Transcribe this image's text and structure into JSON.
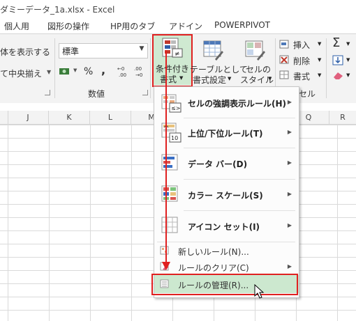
{
  "window": {
    "title": "ダミーデータ_1a.xlsx - Excel"
  },
  "tabs": [
    "個人用",
    "図形の操作",
    "HP用のタブ",
    "アドイン",
    "POWERPIVOT"
  ],
  "ribbon": {
    "text_wrap": "体を表示する",
    "merge_center": "て中央揃え",
    "number_format": "標準",
    "percent": "%",
    "comma": ",",
    "number_group": "数値",
    "cond_format_l1": "条件付き",
    "cond_format_l2": "書式",
    "table_format_l1": "テーブルとして",
    "table_format_l2": "書式設定",
    "cell_style_l1": "セルの",
    "cell_style_l2": "スタイル",
    "insert": "挿入",
    "delete": "削除",
    "format": "書式",
    "cells_group": "セル"
  },
  "columns": [
    "J",
    "K",
    "L",
    "M",
    "Q",
    "R"
  ],
  "menu": {
    "items": [
      {
        "label": "セルの強調表示ルール(H)",
        "icon": "highlight-rules-icon"
      },
      {
        "label": "上位/下位ルール(T)",
        "icon": "top-bottom-rules-icon"
      },
      {
        "label": "データ バー(D)",
        "icon": "data-bars-icon"
      },
      {
        "label": "カラー スケール(S)",
        "icon": "color-scales-icon"
      },
      {
        "label": "アイコン セット(I)",
        "icon": "icon-sets-icon"
      }
    ],
    "new_rule": "新しいルール(N)...",
    "clear_rules": "ルールのクリア(C)",
    "manage_rules": "ルールの管理(R)..."
  },
  "colors": {
    "accent": "#217346",
    "highlight": "#cce8cf",
    "annotation": "#e02020"
  }
}
